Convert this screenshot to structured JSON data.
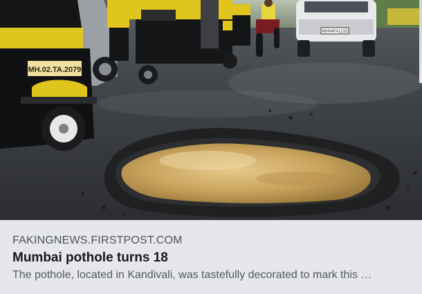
{
  "link_card": {
    "domain": "FAKINGNEWS.FIRSTPOST.COM",
    "headline": "Mumbai pothole turns 18",
    "description": "The pothole, located in Kandivali, was tastefully decorated to mark this …",
    "image": {
      "auto_plate": "MH.02.TA.2079",
      "car_plate": "MH04FA1215"
    }
  }
}
